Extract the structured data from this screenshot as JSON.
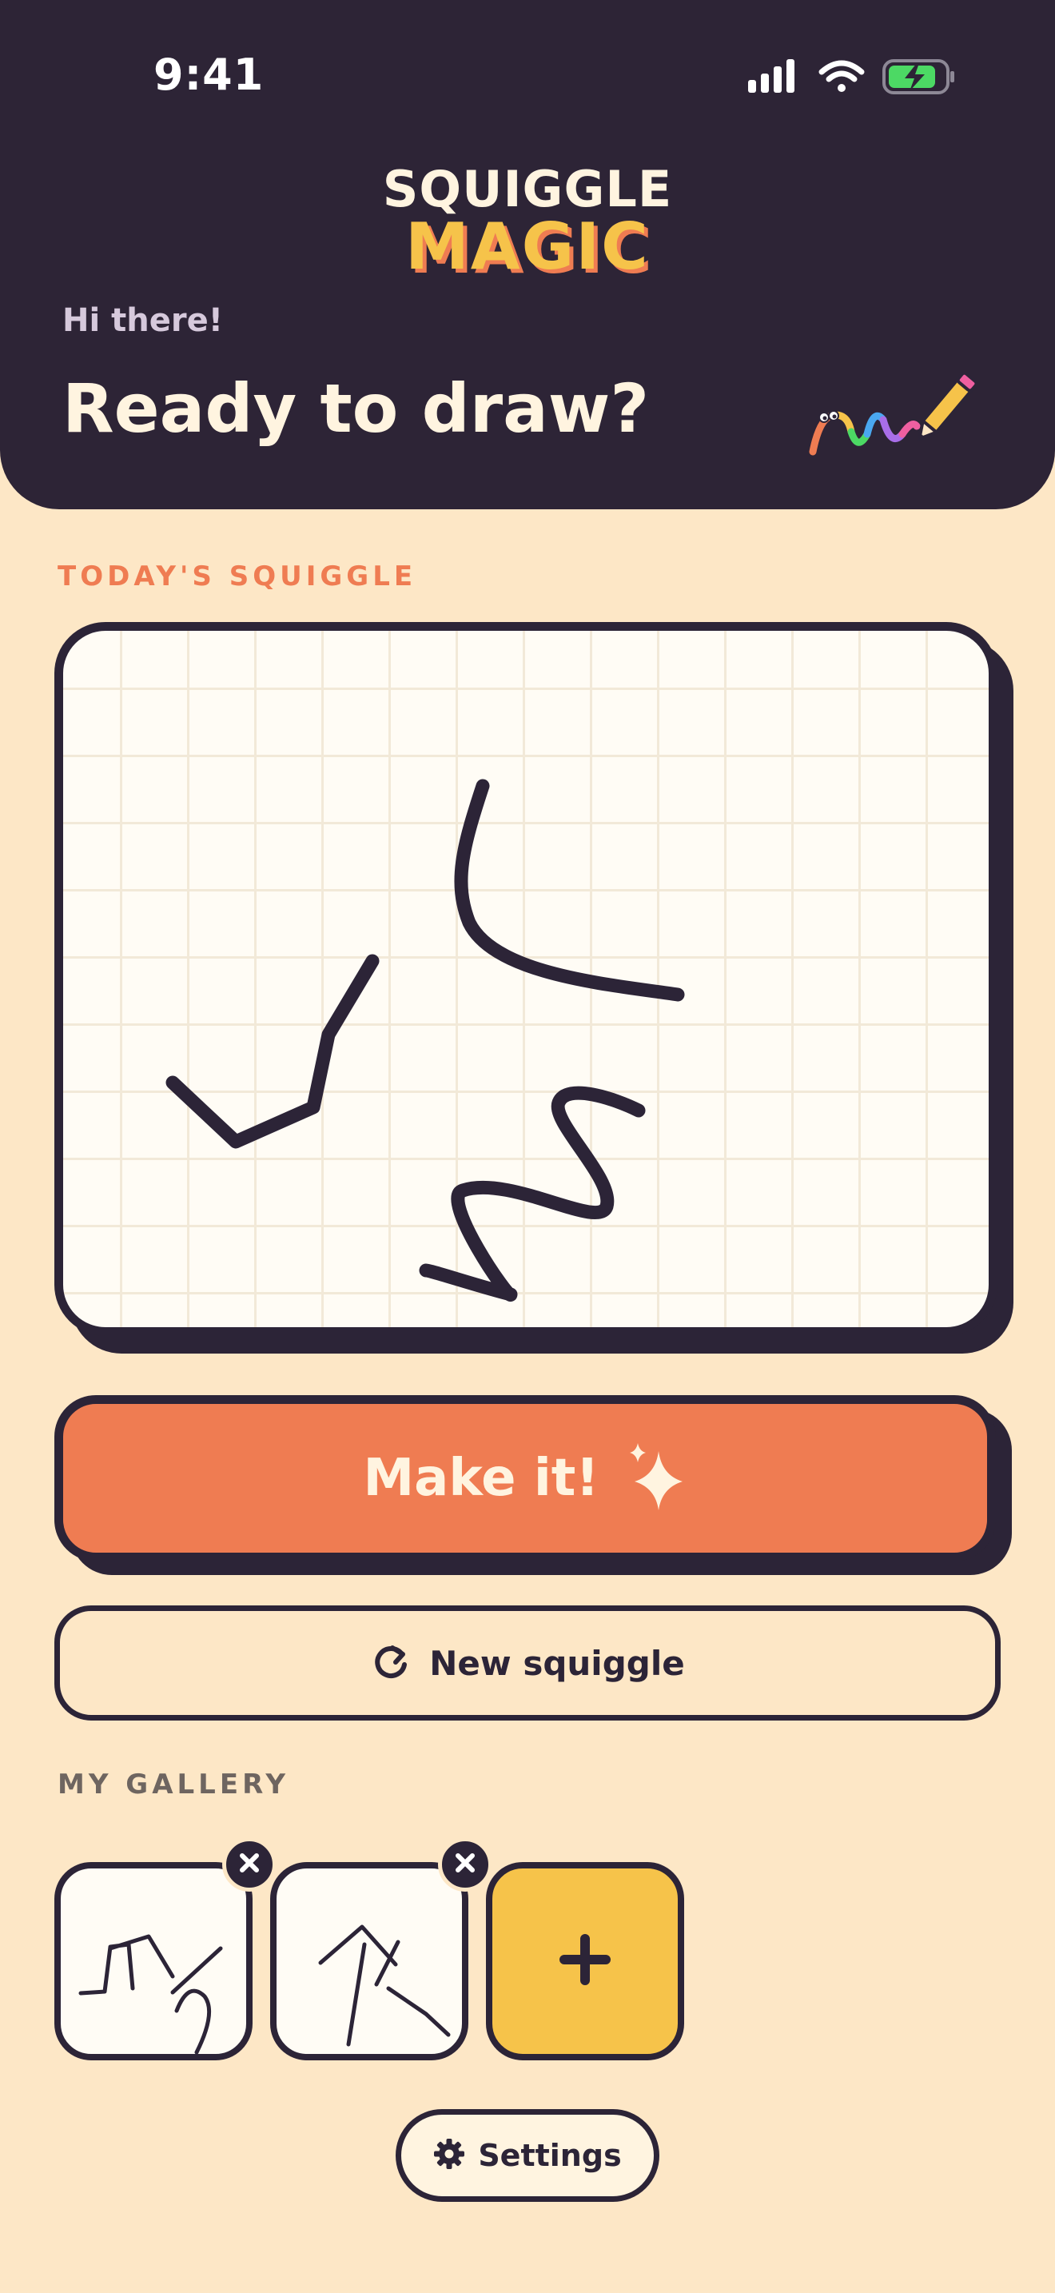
{
  "status_bar": {
    "time": "9:41"
  },
  "app": {
    "logo_line1": "SQUIGGLE",
    "logo_line2": "MAGIC"
  },
  "header": {
    "greeting": "Hi there!",
    "headline": "Ready to draw?"
  },
  "sections": {
    "today": "TODAY'S SQUIGGLE",
    "gallery": "MY GALLERY"
  },
  "actions": {
    "make_label": "Make it!",
    "new_label": "New squiggle",
    "settings_label": "Settings"
  },
  "colors": {
    "header_bg": "#2d2436",
    "page_bg": "#fde7c6",
    "accent_orange": "#ef7c52",
    "accent_yellow": "#f6c34a",
    "ink": "#2c2437",
    "paper": "#fffcf5"
  },
  "icons": [
    "signal-icon",
    "wifi-icon",
    "battery-charging-icon",
    "pencil-squiggle-icon",
    "sparkle-icon",
    "refresh-icon",
    "close-icon",
    "plus-icon",
    "gear-icon"
  ]
}
